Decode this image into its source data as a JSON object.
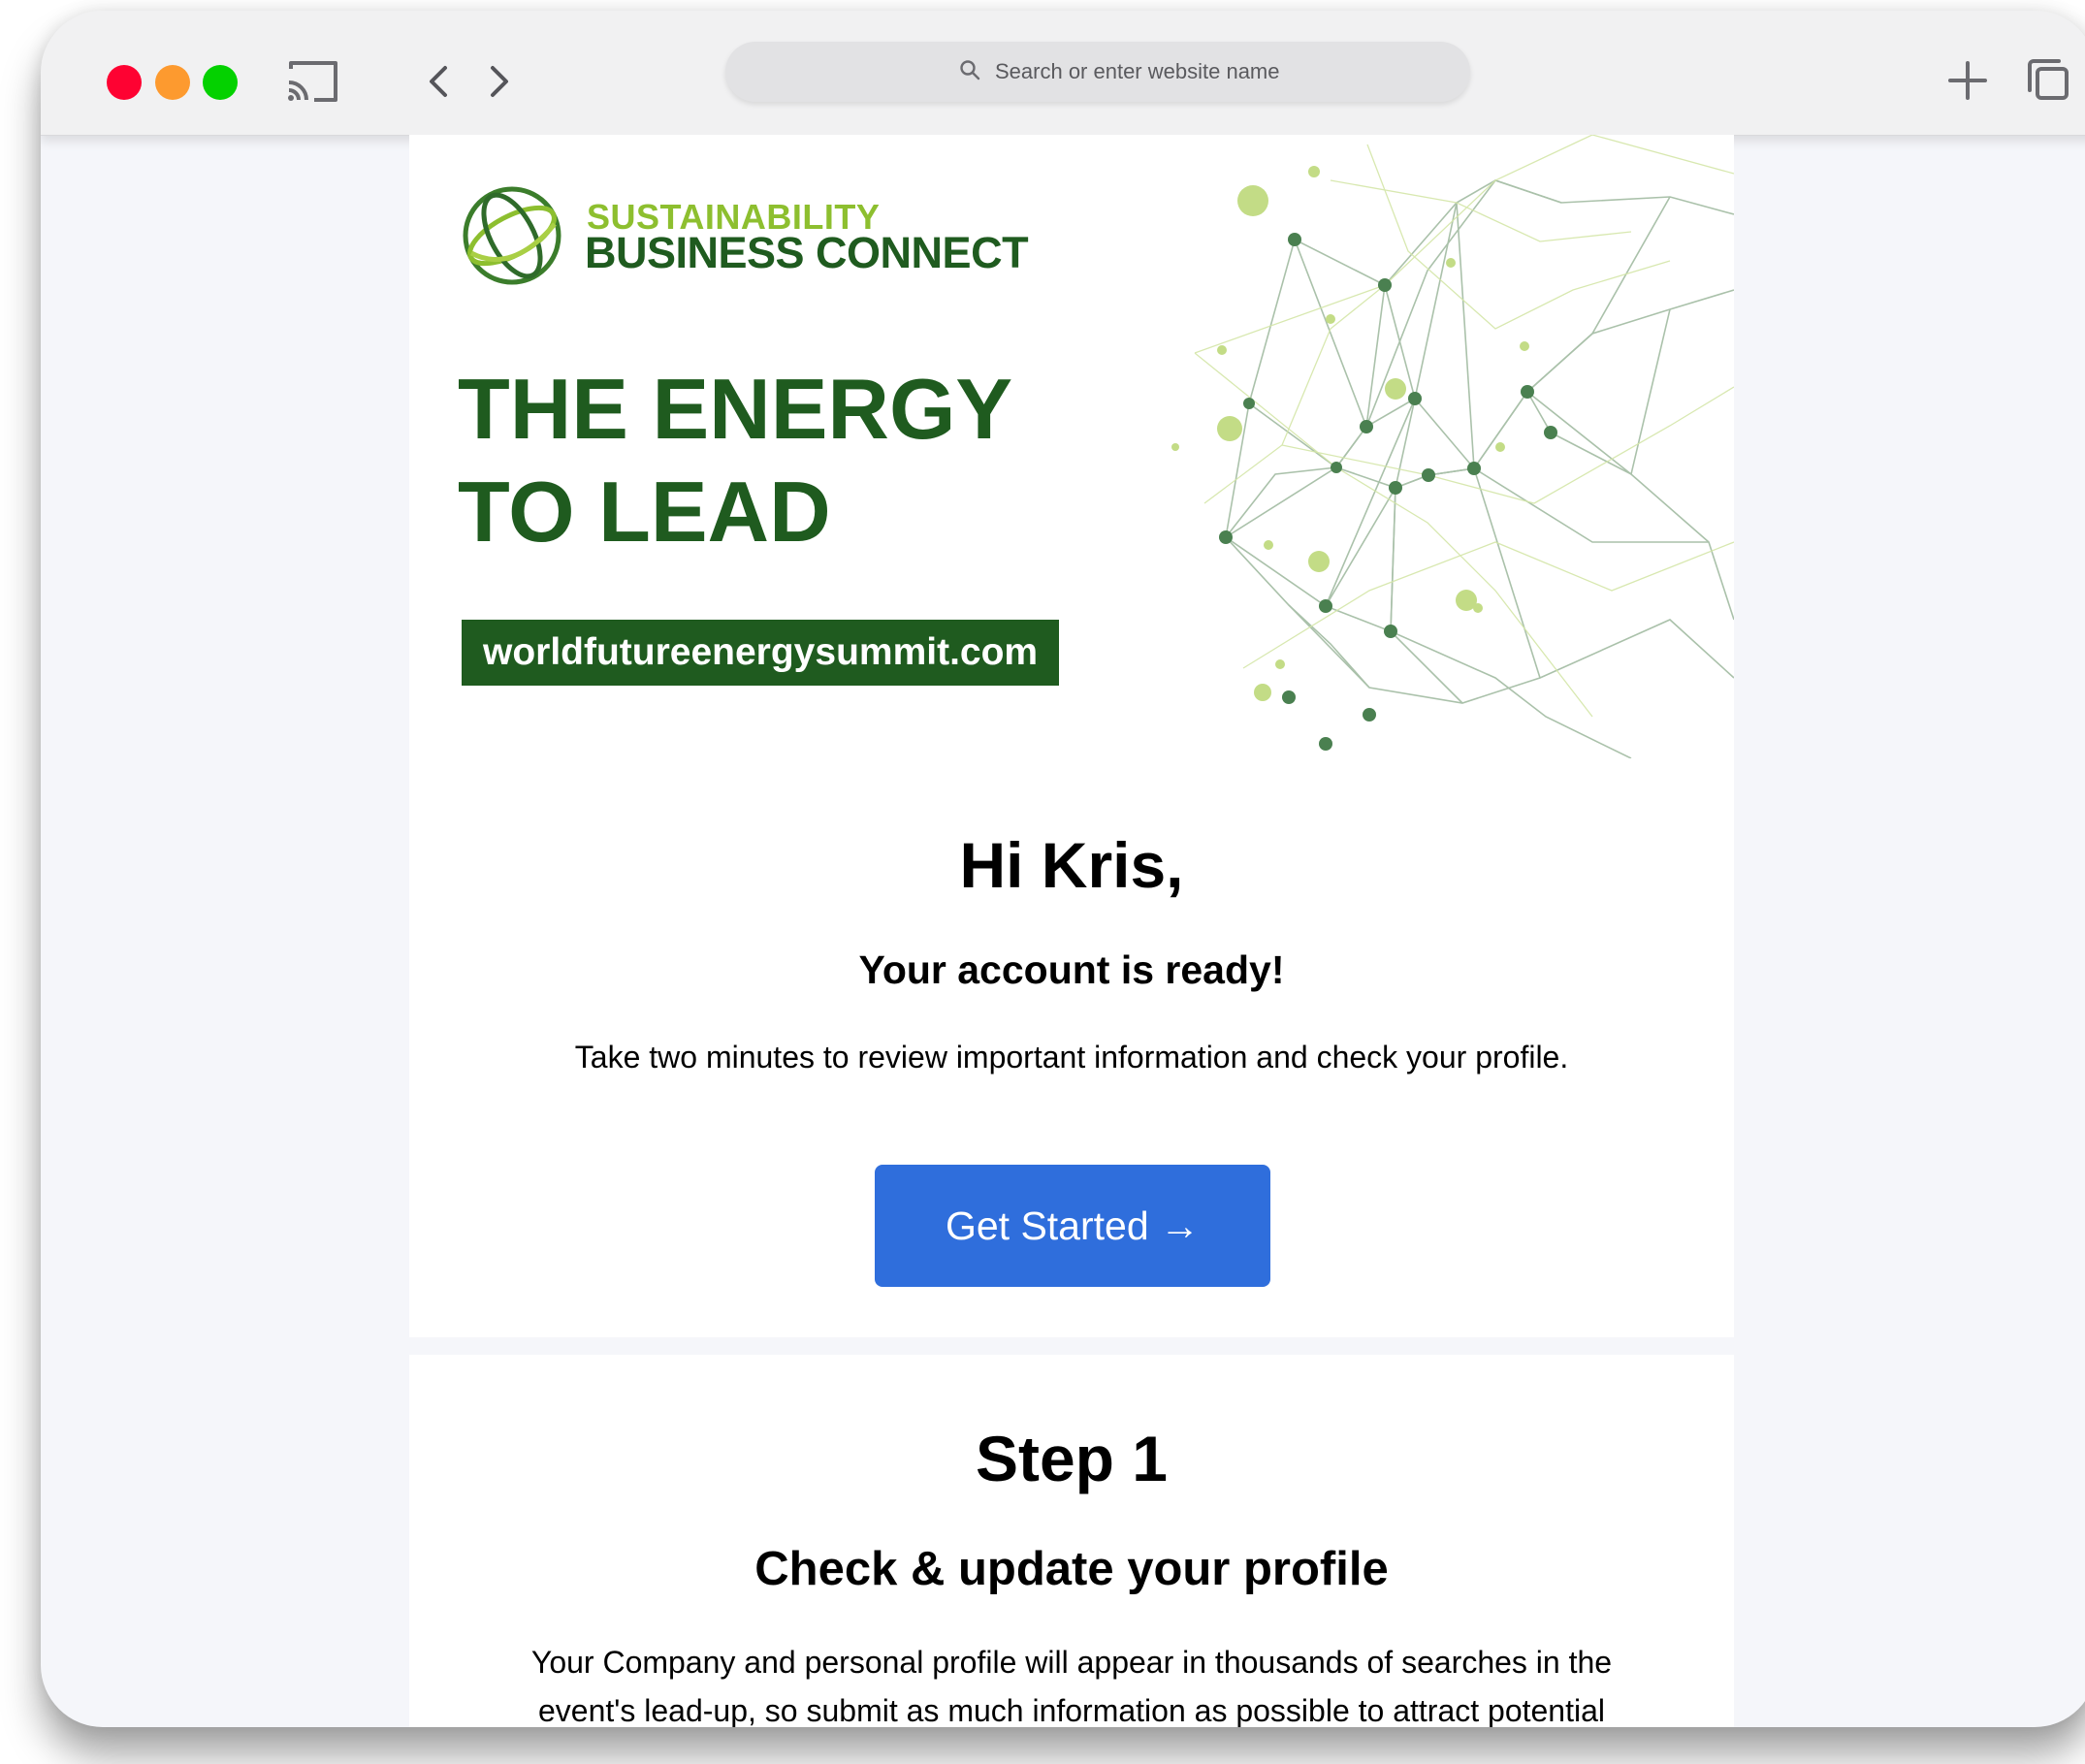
{
  "browser": {
    "address_placeholder": "Search or enter website name",
    "icons": [
      "cast-icon",
      "back-icon",
      "forward-icon",
      "search-icon",
      "plus-icon",
      "tabs-icon"
    ]
  },
  "banner": {
    "logo_line1": "SUSTAINABILITY",
    "logo_line2": "BUSINESS CONNECT",
    "headline_line1": "THE ENERGY",
    "headline_line2": "TO LEAD",
    "url": "worldfutureenergysummit.com"
  },
  "welcome": {
    "greeting": "Hi Kris,",
    "subtitle": "Your account is ready!",
    "body": "Take two minutes to review important information and check your profile.",
    "cta_label": "Get Started →"
  },
  "step1": {
    "title": "Step 1",
    "subtitle": "Check & update your profile",
    "body_line1": "Your Company and personal profile will appear in thousands of searches in the",
    "body_line2": "event's lead-up, so submit as much information as possible to attract potential"
  },
  "colors": {
    "brand_dark_green": "#1f5b1f",
    "brand_light_green": "#8dbf2f",
    "cta_blue": "#2f6edc",
    "page_background": "#f5f6fa"
  }
}
